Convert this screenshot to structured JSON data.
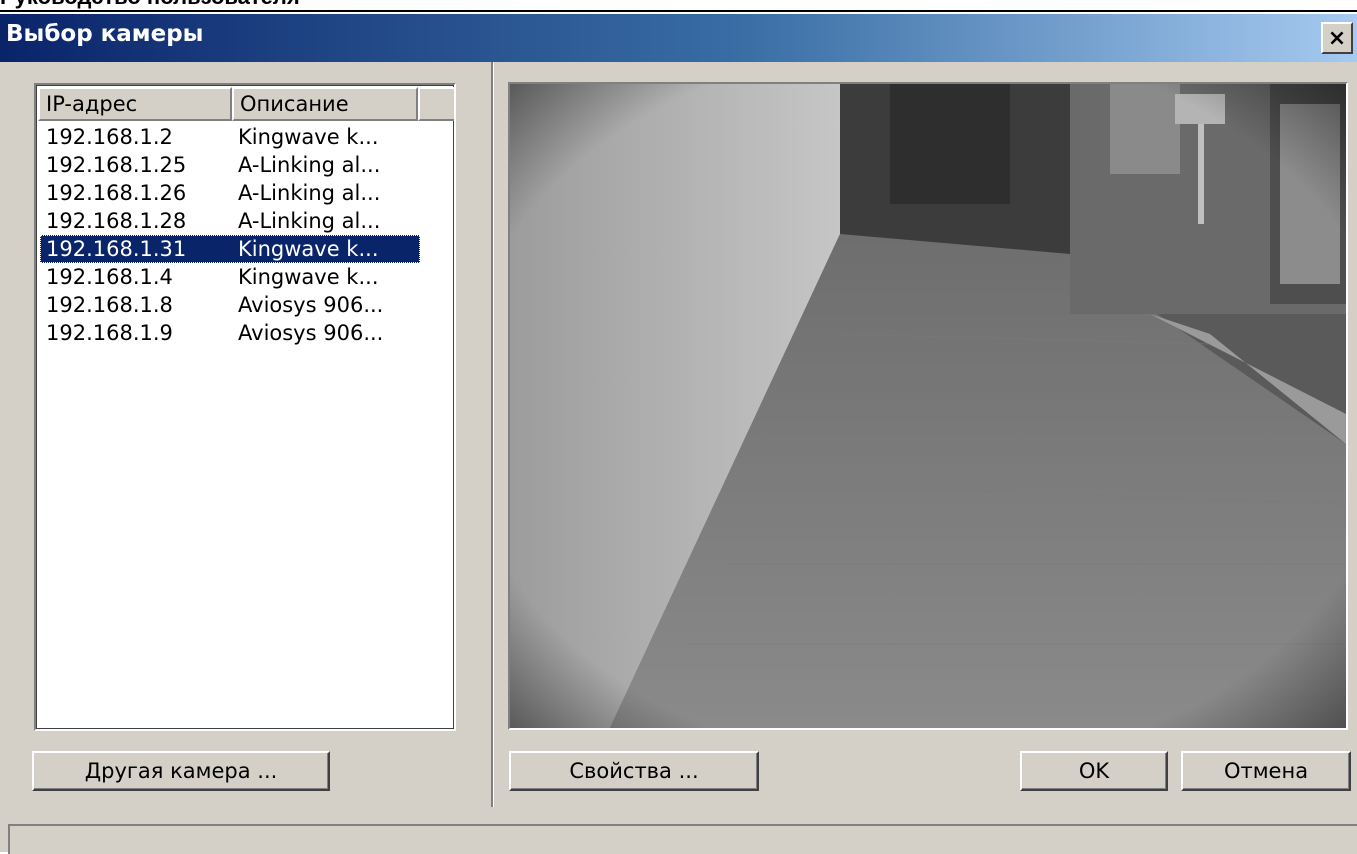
{
  "document": {
    "header": "Руководство пользователя"
  },
  "dialog": {
    "title": "Выбор камеры",
    "close_glyph": "×"
  },
  "camera_list": {
    "columns": [
      "IP-адрес",
      "Описание"
    ],
    "rows": [
      {
        "ip": "192.168.1.2",
        "description": "Kingwave k..."
      },
      {
        "ip": "192.168.1.25",
        "description": "A-Linking al..."
      },
      {
        "ip": "192.168.1.26",
        "description": "A-Linking al..."
      },
      {
        "ip": "192.168.1.28",
        "description": "A-Linking al..."
      },
      {
        "ip": "192.168.1.31",
        "description": "Kingwave k..."
      },
      {
        "ip": "192.168.1.4",
        "description": "Kingwave k..."
      },
      {
        "ip": "192.168.1.8",
        "description": "Aviosys 906..."
      },
      {
        "ip": "192.168.1.9",
        "description": "Aviosys 906..."
      }
    ],
    "selected_index": 4
  },
  "buttons": {
    "other_camera": "Другая камера ...",
    "properties": "Свойства ...",
    "ok": "OK",
    "cancel": "Отмена"
  },
  "colors": {
    "title_gradient_start": "#0a246a",
    "title_gradient_end": "#a6caf0",
    "selection": "#0a246a",
    "face": "#d4d0c8"
  }
}
